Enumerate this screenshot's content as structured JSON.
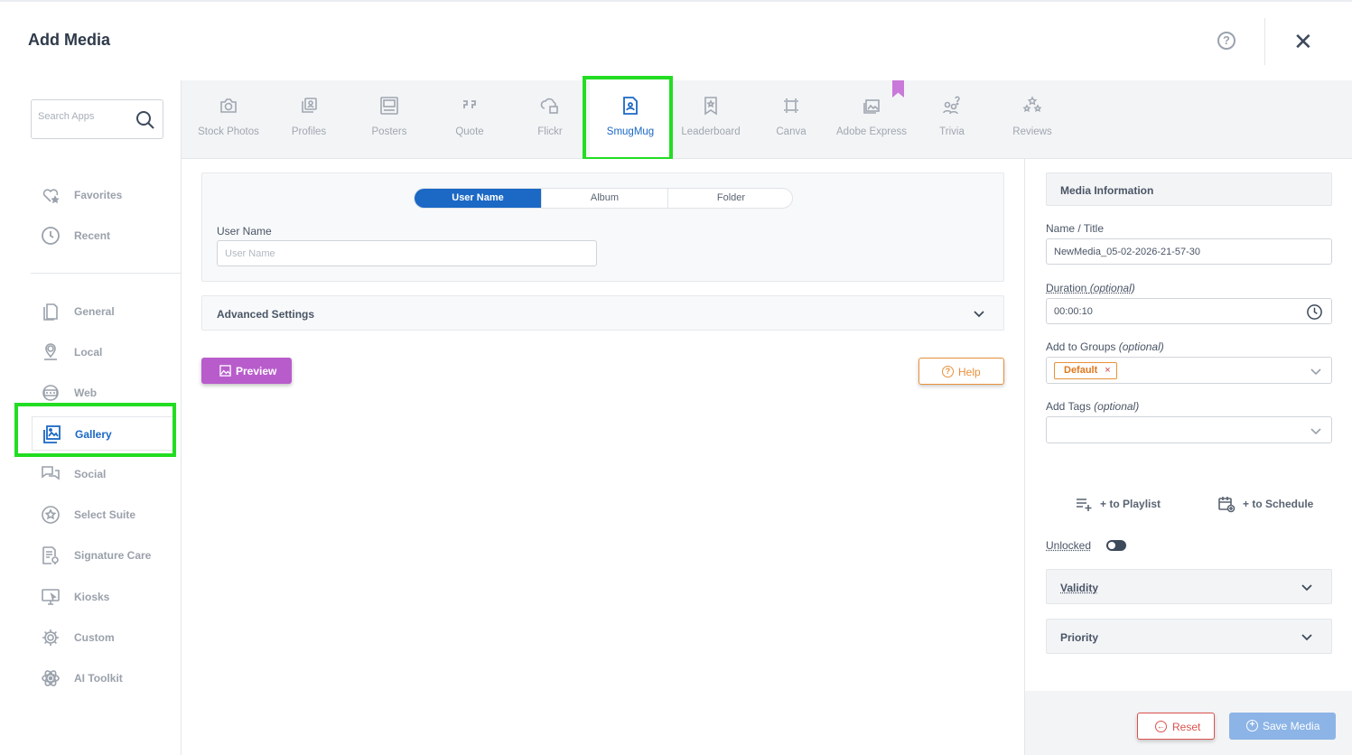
{
  "header": {
    "title": "Add Media",
    "help_glyph": "?",
    "close_glyph": "✕"
  },
  "search": {
    "placeholder": "Search Apps"
  },
  "apps": [
    {
      "label": "Stock Photos",
      "icon": "camera-icon"
    },
    {
      "label": "Profiles",
      "icon": "profiles-icon"
    },
    {
      "label": "Posters",
      "icon": "posters-icon"
    },
    {
      "label": "Quote",
      "icon": "quote-icon"
    },
    {
      "label": "Flickr",
      "icon": "flickr-icon"
    },
    {
      "label": "SmugMug",
      "icon": "smugmug-icon",
      "active": true
    },
    {
      "label": "Leaderboard",
      "icon": "leaderboard-icon"
    },
    {
      "label": "Canva",
      "icon": "canva-icon"
    },
    {
      "label": "Adobe Express",
      "icon": "adobe-express-icon"
    },
    {
      "label": "Trivia",
      "icon": "trivia-icon"
    },
    {
      "label": "Reviews",
      "icon": "reviews-icon"
    }
  ],
  "sidebar": {
    "items": [
      {
        "label": "Favorites",
        "icon": "favorites-icon"
      },
      {
        "label": "Recent",
        "icon": "clock-icon"
      },
      {
        "label": "General",
        "icon": "document-icon"
      },
      {
        "label": "Local",
        "icon": "location-icon"
      },
      {
        "label": "Web",
        "icon": "web-icon"
      },
      {
        "label": "Gallery",
        "icon": "gallery-icon",
        "active": true
      },
      {
        "label": "Social",
        "icon": "social-icon"
      },
      {
        "label": "Select Suite",
        "icon": "star-circle-icon"
      },
      {
        "label": "Signature Care",
        "icon": "signature-care-icon"
      },
      {
        "label": "Kiosks",
        "icon": "kiosk-icon"
      },
      {
        "label": "Custom",
        "icon": "gear-icon"
      },
      {
        "label": "AI Toolkit",
        "icon": "ai-toolkit-icon"
      }
    ]
  },
  "source": {
    "tabs": [
      "User Name",
      "Album",
      "Folder"
    ],
    "active_tab": "User Name",
    "username_label": "User Name",
    "username_placeholder": "User Name",
    "username_value": "",
    "advanced_label": "Advanced Settings",
    "preview_label": "Preview",
    "help_label": "Help"
  },
  "media_info": {
    "heading": "Media Information",
    "name_label": "Name / Title",
    "name_value": "NewMedia_05-02-2026-21-57-30",
    "duration_label": "Duration",
    "duration_optional": "(optional)",
    "duration_value": "00:00:10",
    "groups_label": "Add to Groups",
    "groups_optional": "(optional)",
    "groups_selected": [
      "Default"
    ],
    "chip_remove_glyph": "×",
    "tags_label": "Add Tags",
    "tags_optional": "(optional)",
    "playlist_label": "+ to Playlist",
    "schedule_label": "+ to Schedule",
    "unlocked_label": "Unlocked",
    "unlocked_on": false,
    "validity_label": "Validity",
    "priority_label": "Priority",
    "reset_label": "Reset",
    "save_label": "Save Media"
  },
  "colors": {
    "accent": "#1b68c5",
    "preview": "#b85ccc",
    "help": "#e8913a",
    "reset": "#d9534f",
    "save": "#8cb4e6",
    "highlight": "#22dd22"
  }
}
